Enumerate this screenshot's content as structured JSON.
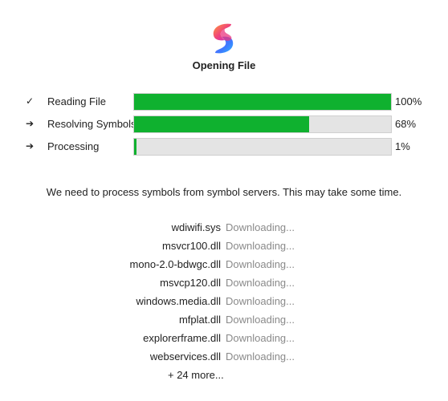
{
  "dialog": {
    "title": "Opening File",
    "logo_icon": "app-logo-s-gradient"
  },
  "progress": [
    {
      "label": "Reading File",
      "percent_text": "100%",
      "value": 1.0,
      "icon": "check-icon",
      "glyph": "✓"
    },
    {
      "label": "Resolving Symbols",
      "percent_text": "68%",
      "value": 0.68,
      "icon": "arrow-right-icon",
      "glyph": "➔"
    },
    {
      "label": "Processing",
      "percent_text": "1%",
      "value": 0.01,
      "icon": "arrow-right-icon",
      "glyph": "➔"
    }
  ],
  "colors": {
    "bar_fill": "#0fb12f",
    "bar_track": "#e4e4e4",
    "status_text": "#8a8a8a"
  },
  "message": "We need to process symbols from symbol servers. This may take some time.",
  "files": [
    {
      "name": "wdiwifi.sys",
      "status": "Downloading..."
    },
    {
      "name": "msvcr100.dll",
      "status": "Downloading..."
    },
    {
      "name": "mono-2.0-bdwgc.dll",
      "status": "Downloading..."
    },
    {
      "name": "msvcp120.dll",
      "status": "Downloading..."
    },
    {
      "name": "windows.media.dll",
      "status": "Downloading..."
    },
    {
      "name": "mfplat.dll",
      "status": "Downloading..."
    },
    {
      "name": "explorerframe.dll",
      "status": "Downloading..."
    },
    {
      "name": "webservices.dll",
      "status": "Downloading..."
    }
  ],
  "more_text": "+ 24 more..."
}
